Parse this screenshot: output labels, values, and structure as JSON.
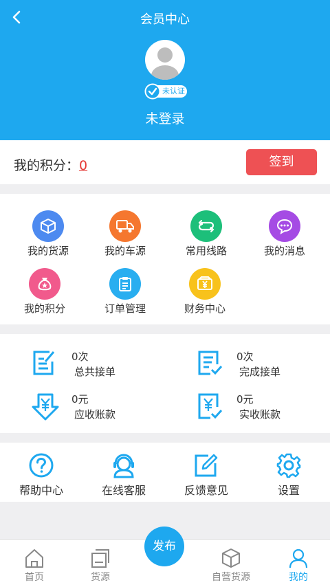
{
  "header": {
    "title": "会员中心",
    "verify_badge": "未认证",
    "username": "未登录"
  },
  "points": {
    "label": "我的积分：",
    "value": "0",
    "signin_label": "签到"
  },
  "grid": {
    "items": [
      {
        "label": "我的货源",
        "icon": "box-icon",
        "color": "#4d8af0"
      },
      {
        "label": "我的车源",
        "icon": "truck-icon",
        "color": "#f5772f"
      },
      {
        "label": "常用线路",
        "icon": "route-icon",
        "color": "#1dbf7a"
      },
      {
        "label": "我的消息",
        "icon": "message-icon",
        "color": "#a54be4"
      },
      {
        "label": "我的积分",
        "icon": "money-bag-icon",
        "color": "#f15a8c"
      },
      {
        "label": "订单管理",
        "icon": "clipboard-icon",
        "color": "#29aef0"
      },
      {
        "label": "财务中心",
        "icon": "wallet-icon",
        "color": "#f8c21c"
      }
    ]
  },
  "stats": {
    "items": [
      {
        "value": "0次",
        "label": "总共接单",
        "icon": "edit-document-icon"
      },
      {
        "value": "0次",
        "label": "完成接单",
        "icon": "checked-document-icon"
      },
      {
        "value": "0元",
        "label": "应收账款",
        "icon": "yuan-down-icon"
      },
      {
        "value": "0元",
        "label": "实收账款",
        "icon": "yuan-document-icon"
      }
    ]
  },
  "tools": {
    "items": [
      {
        "label": "帮助中心",
        "icon": "help-icon"
      },
      {
        "label": "在线客服",
        "icon": "headset-icon"
      },
      {
        "label": "反馈意见",
        "icon": "feedback-icon"
      },
      {
        "label": "设置",
        "icon": "gear-icon"
      }
    ]
  },
  "tabbar": {
    "items": [
      {
        "label": "首页",
        "icon": "home-icon"
      },
      {
        "label": "货源",
        "icon": "cargo-icon"
      },
      {
        "label": "自营货源",
        "icon": "package-icon"
      },
      {
        "label": "我的",
        "icon": "user-icon"
      }
    ],
    "publish_label": "发布",
    "active": "我的"
  },
  "colors": {
    "primary": "#1ea8ef",
    "signin": "#ee5154",
    "points_value": "#e53935"
  }
}
